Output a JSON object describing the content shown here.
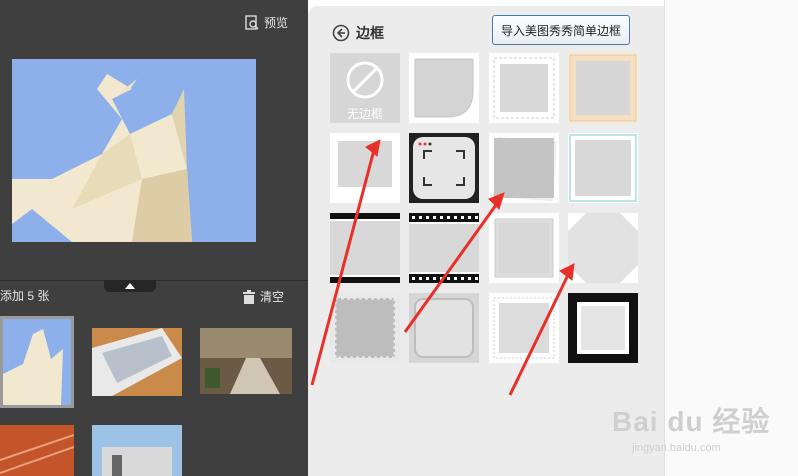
{
  "left_panel": {
    "preview_label": "预览",
    "added_count": "添加 5 张",
    "clear_label": "清空"
  },
  "border_panel": {
    "title": "边框",
    "import_button": "导入美图秀秀简单边框",
    "tiles": [
      {
        "name": "no-border",
        "label": "无边框"
      },
      {
        "name": "rounded-corner"
      },
      {
        "name": "stamp-edge"
      },
      {
        "name": "cream-frame"
      },
      {
        "name": "polaroid"
      },
      {
        "name": "camera-viewfinder"
      },
      {
        "name": "gray-shadow"
      },
      {
        "name": "light-blue-frame"
      },
      {
        "name": "black-bars"
      },
      {
        "name": "film-strip"
      },
      {
        "name": "inset-shadow"
      },
      {
        "name": "folded-corners"
      },
      {
        "name": "gray-stamp"
      },
      {
        "name": "rounded-inset"
      },
      {
        "name": "lace-edge"
      },
      {
        "name": "thick-black-frame"
      }
    ]
  },
  "watermark": {
    "brand": "Bai du 经验",
    "url": "jingyan.baidu.com"
  },
  "colors": {
    "left_bg": "#3f3f3f",
    "mid_bg": "#ececec",
    "arrow": "#e8302a",
    "accent_border": "#4a78b5"
  }
}
